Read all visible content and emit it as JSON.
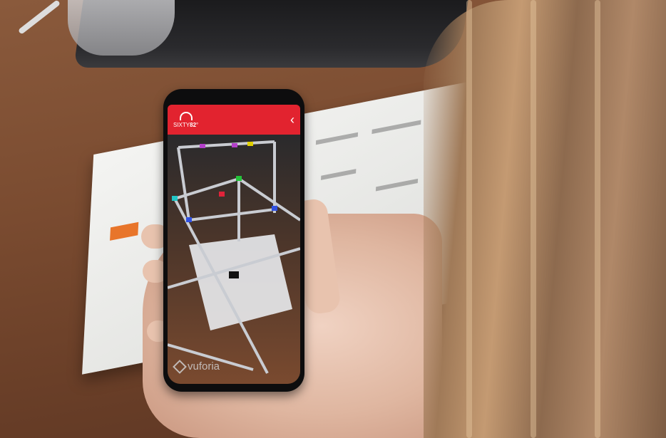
{
  "photo": {
    "subject": "phone-ar-app",
    "colors": {
      "app_bar": "#e2232f",
      "desk": "#7a4b30",
      "phone_body": "#0d0d0e"
    }
  },
  "app": {
    "logo_text_prefix": "SIXTY",
    "logo_text_number": "82",
    "logo_text_suffix": "°",
    "back_icon": "chevron-left-icon",
    "watermark": "vuforia"
  }
}
